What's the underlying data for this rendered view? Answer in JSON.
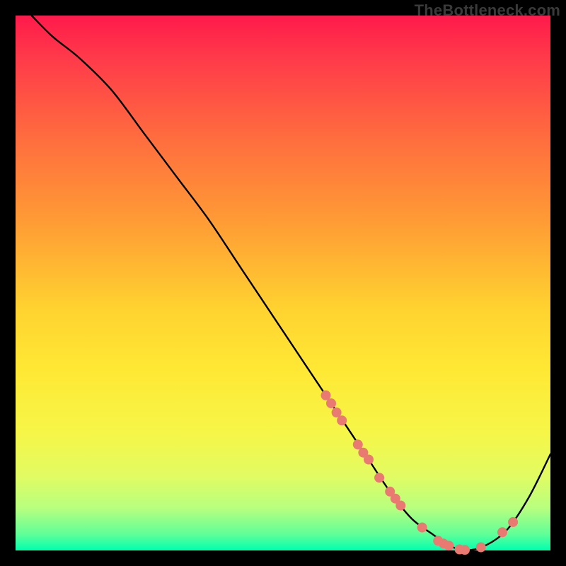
{
  "watermark": "TheBottleneck.com",
  "chart_data": {
    "type": "line",
    "title": "",
    "xlabel": "",
    "ylabel": "",
    "xlim": [
      0,
      100
    ],
    "ylim": [
      0,
      100
    ],
    "legend": false,
    "grid": false,
    "background": "rainbow-vertical",
    "series": [
      {
        "name": "bottleneck-curve",
        "color": "#000000",
        "x": [
          3,
          7,
          12,
          18,
          24,
          30,
          36,
          42,
          48,
          54,
          58,
          62,
          66,
          70,
          74,
          78,
          81,
          84,
          88,
          92,
          96,
          100
        ],
        "y": [
          100,
          96,
          92,
          86,
          78,
          70,
          62,
          53,
          44,
          35,
          29,
          23,
          17,
          11,
          6,
          3,
          1,
          0,
          1,
          4,
          10,
          18
        ]
      }
    ],
    "markers": {
      "name": "highlight-points",
      "color": "#e97a72",
      "points": [
        {
          "x": 58,
          "y": 29
        },
        {
          "x": 59,
          "y": 27.5
        },
        {
          "x": 60,
          "y": 25.8
        },
        {
          "x": 61,
          "y": 24.3
        },
        {
          "x": 64,
          "y": 19.8
        },
        {
          "x": 65,
          "y": 18.3
        },
        {
          "x": 66,
          "y": 17
        },
        {
          "x": 68,
          "y": 13.6
        },
        {
          "x": 70,
          "y": 11
        },
        {
          "x": 71,
          "y": 9.7
        },
        {
          "x": 72,
          "y": 8.4
        },
        {
          "x": 76,
          "y": 4.3
        },
        {
          "x": 79,
          "y": 1.8
        },
        {
          "x": 80,
          "y": 1.3
        },
        {
          "x": 81,
          "y": 0.9
        },
        {
          "x": 83,
          "y": 0.2
        },
        {
          "x": 84,
          "y": 0.1
        },
        {
          "x": 87,
          "y": 0.6
        },
        {
          "x": 91,
          "y": 3.4
        },
        {
          "x": 93,
          "y": 5.3
        }
      ]
    }
  }
}
